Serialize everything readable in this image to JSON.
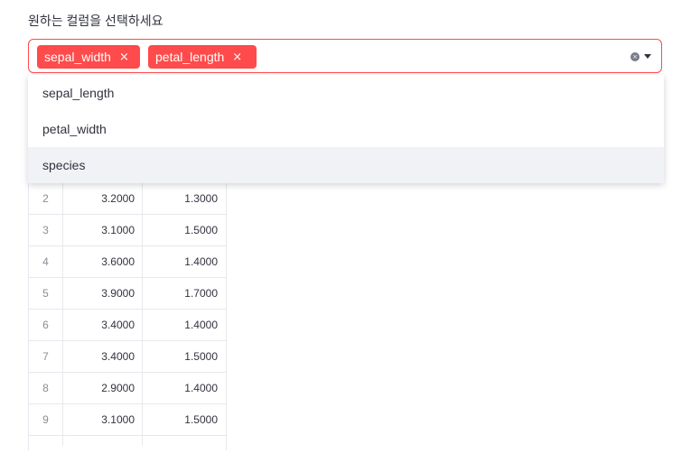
{
  "selector": {
    "label": "원하는 컬럼을 선택하세요",
    "selected": [
      {
        "label": "sepal_width",
        "remove": "×"
      },
      {
        "label": "petal_length",
        "remove": "×"
      }
    ],
    "clear_glyph": "×",
    "accent_color": "#ff4b4b"
  },
  "dropdown": {
    "options": [
      "sepal_length",
      "petal_width",
      "species"
    ],
    "highlighted": "species"
  },
  "table": {
    "rows": [
      {
        "index": "2",
        "sepal_width": "3.2000",
        "petal_length": "1.3000"
      },
      {
        "index": "3",
        "sepal_width": "3.1000",
        "petal_length": "1.5000"
      },
      {
        "index": "4",
        "sepal_width": "3.6000",
        "petal_length": "1.4000"
      },
      {
        "index": "5",
        "sepal_width": "3.9000",
        "petal_length": "1.7000"
      },
      {
        "index": "6",
        "sepal_width": "3.4000",
        "petal_length": "1.4000"
      },
      {
        "index": "7",
        "sepal_width": "3.4000",
        "petal_length": "1.5000"
      },
      {
        "index": "8",
        "sepal_width": "2.9000",
        "petal_length": "1.4000"
      },
      {
        "index": "9",
        "sepal_width": "3.1000",
        "petal_length": "1.5000"
      }
    ]
  }
}
